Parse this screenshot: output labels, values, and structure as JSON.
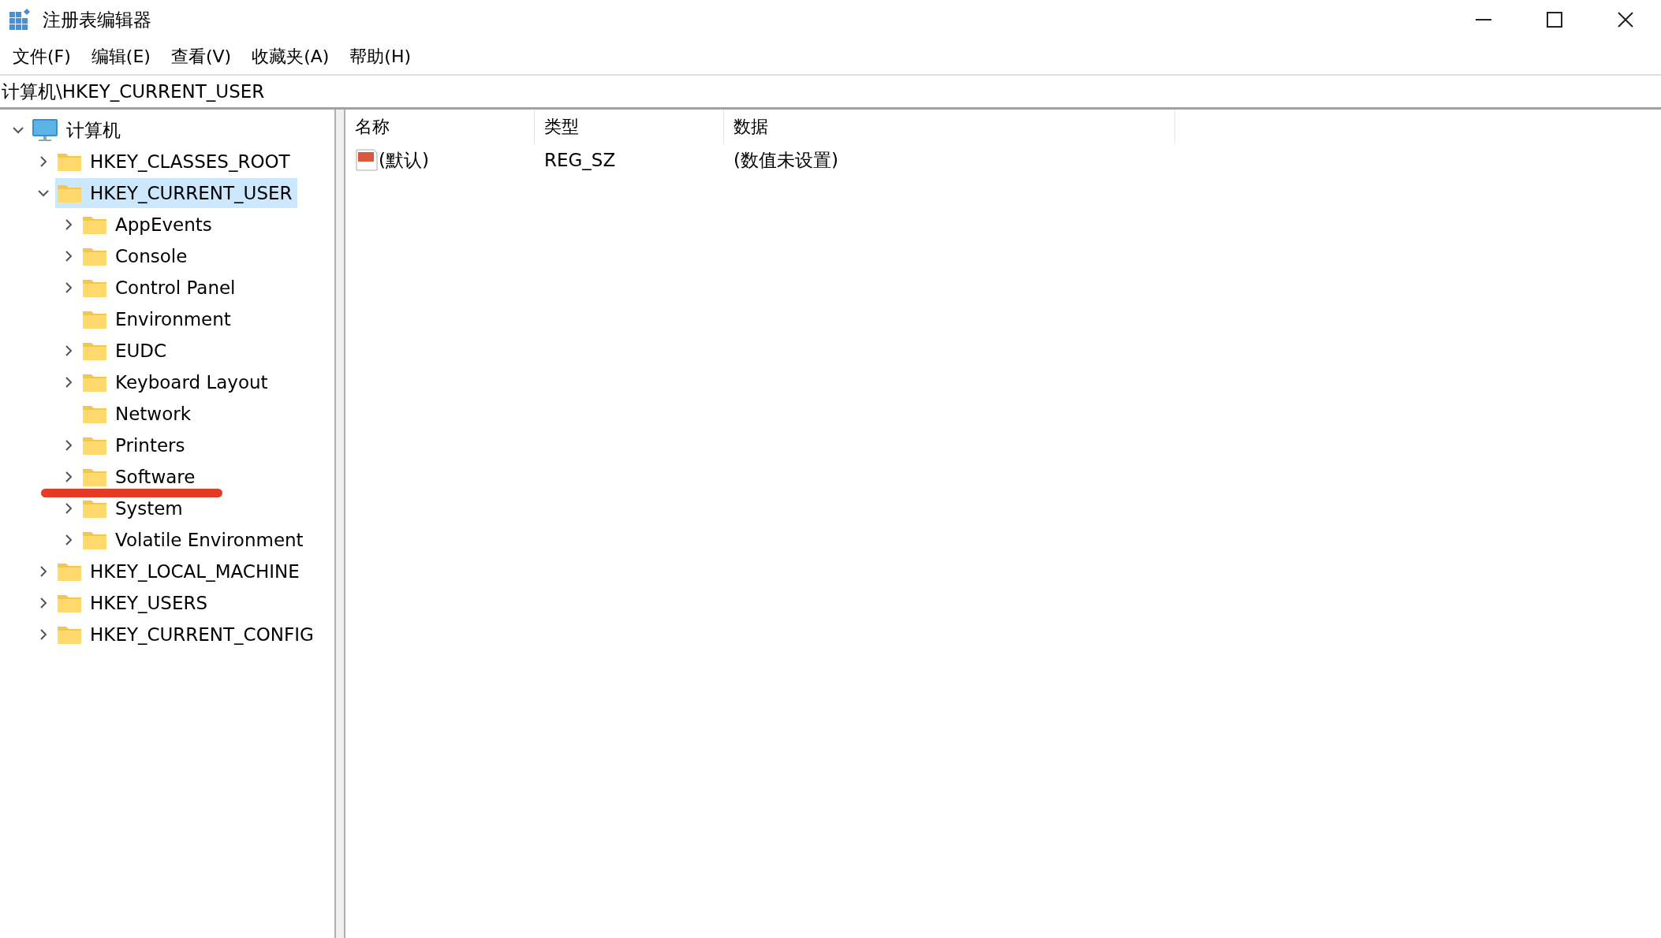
{
  "window": {
    "title": "注册表编辑器"
  },
  "menu": [
    {
      "label": "文件(F)"
    },
    {
      "label": "编辑(E)"
    },
    {
      "label": "查看(V)"
    },
    {
      "label": "收藏夹(A)"
    },
    {
      "label": "帮助(H)"
    }
  ],
  "address": {
    "value": "计算机\\HKEY_CURRENT_USER"
  },
  "tree": [
    {
      "label": "计算机",
      "kind": "computer",
      "expandable": true,
      "expanded": true,
      "selected": false,
      "children": [
        {
          "label": "HKEY_CLASSES_ROOT",
          "kind": "folder",
          "expandable": true,
          "expanded": false,
          "selected": false
        },
        {
          "label": "HKEY_CURRENT_USER",
          "kind": "folder",
          "expandable": true,
          "expanded": true,
          "selected": true,
          "children": [
            {
              "label": "AppEvents",
              "kind": "folder",
              "expandable": true,
              "expanded": false,
              "selected": false
            },
            {
              "label": "Console",
              "kind": "folder",
              "expandable": true,
              "expanded": false,
              "selected": false
            },
            {
              "label": "Control Panel",
              "kind": "folder",
              "expandable": true,
              "expanded": false,
              "selected": false
            },
            {
              "label": "Environment",
              "kind": "folder",
              "expandable": false,
              "expanded": false,
              "selected": false
            },
            {
              "label": "EUDC",
              "kind": "folder",
              "expandable": true,
              "expanded": false,
              "selected": false
            },
            {
              "label": "Keyboard Layout",
              "kind": "folder",
              "expandable": true,
              "expanded": false,
              "selected": false
            },
            {
              "label": "Network",
              "kind": "folder",
              "expandable": false,
              "expanded": false,
              "selected": false
            },
            {
              "label": "Printers",
              "kind": "folder",
              "expandable": true,
              "expanded": false,
              "selected": false
            },
            {
              "label": "Software",
              "kind": "folder",
              "expandable": true,
              "expanded": false,
              "selected": false,
              "marked": true
            },
            {
              "label": "System",
              "kind": "folder",
              "expandable": true,
              "expanded": false,
              "selected": false
            },
            {
              "label": "Volatile Environment",
              "kind": "folder",
              "expandable": true,
              "expanded": false,
              "selected": false
            }
          ]
        },
        {
          "label": "HKEY_LOCAL_MACHINE",
          "kind": "folder",
          "expandable": true,
          "expanded": false,
          "selected": false
        },
        {
          "label": "HKEY_USERS",
          "kind": "folder",
          "expandable": true,
          "expanded": false,
          "selected": false
        },
        {
          "label": "HKEY_CURRENT_CONFIG",
          "kind": "folder",
          "expandable": true,
          "expanded": false,
          "selected": false
        }
      ]
    }
  ],
  "table": {
    "columns": [
      "名称",
      "类型",
      "数据"
    ],
    "rows": [
      {
        "name": "(默认)",
        "type": "REG_SZ",
        "data": "(数值未设置)",
        "selected": false
      }
    ]
  }
}
